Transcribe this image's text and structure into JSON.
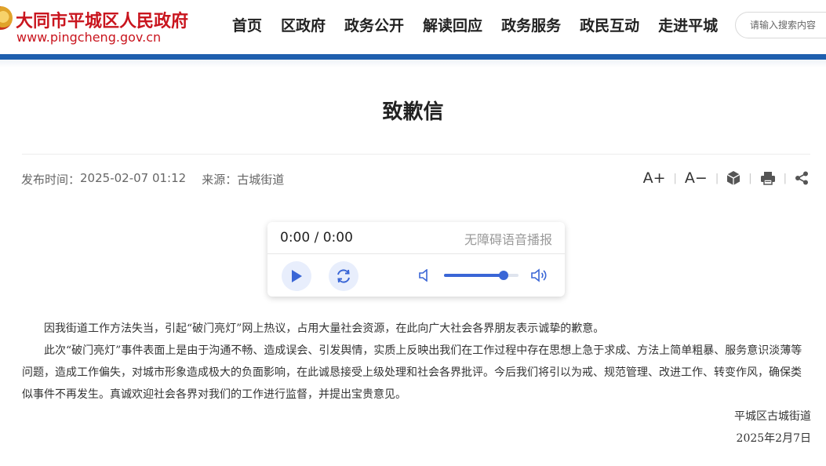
{
  "header": {
    "site_title": "大同市平城区人民政府",
    "site_url": "www.pingcheng.gov.cn",
    "search_placeholder": "请输入搜索内容"
  },
  "nav": [
    "首页",
    "区政府",
    "政务公开",
    "解读回应",
    "政务服务",
    "政民互动",
    "走进平城"
  ],
  "article": {
    "title": "致歉信",
    "publish_label": "发布时间：",
    "publish_time": "2025-02-07 01:12",
    "source_label": "来源：",
    "source": "古城街道",
    "paragraphs": [
      "因我街道工作方法失当，引起“破门亮灯”网上热议，占用大量社会资源，在此向广大社会各界朋友表示诚挚的歉意。",
      "此次“破门亮灯”事件表面上是由于沟通不畅、造成误会、引发舆情，实质上反映出我们在工作过程中存在思想上急于求成、方法上简单粗暴、服务意识淡薄等问题，造成工作偏失，对城市形象造成极大的负面影响，在此诚恳接受上级处理和社会各界批评。今后我们将引以为戒、规范管理、改进工作、转变作风，确保类似事件不再发生。真诚欢迎社会各界对我们的工作进行监督，并提出宝贵意见。"
    ],
    "signature": "平城区古城街道",
    "sign_date": "2025年2月7日"
  },
  "tools": {
    "font_increase": "A+",
    "font_decrease": "A−"
  },
  "player": {
    "time": "0:00 / 0:00",
    "label": "无障碍语音播报",
    "volume": 0.8
  },
  "colors": {
    "brand_red": "#c9151e",
    "bar_blue": "#1f5fae",
    "player_accent": "#3a66d6"
  }
}
